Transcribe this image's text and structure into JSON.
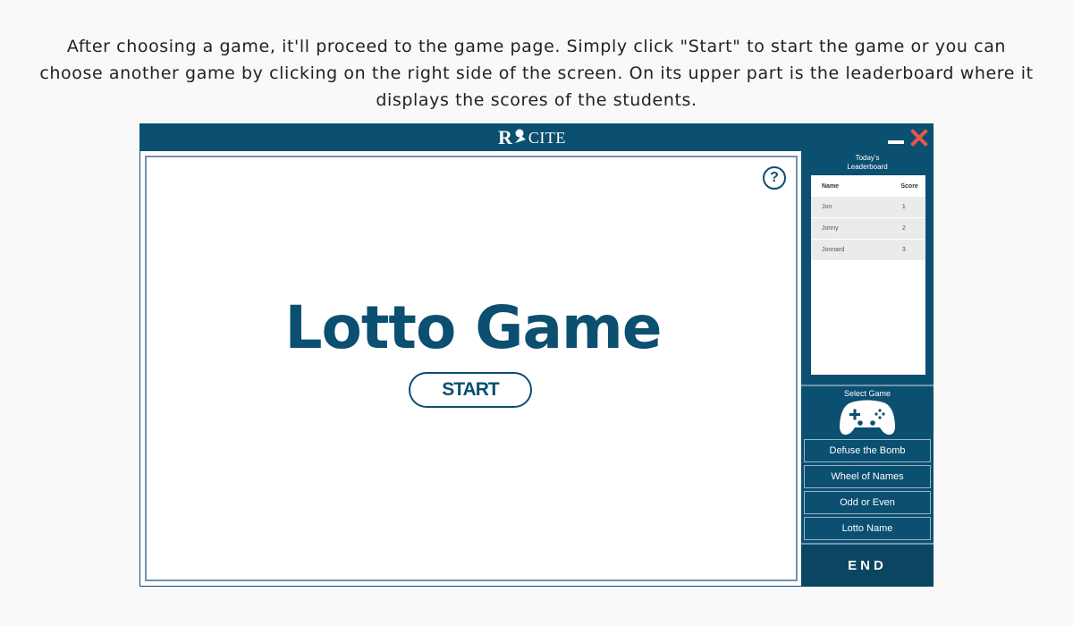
{
  "caption": "After choosing a game, it'll proceed to the game page. Simply click \"Start\" to start the game or you can choose another game by clicking on the right side of the screen. On its upper part is the leaderboard where it displays the scores of the students.",
  "app": {
    "logo_prefix": "R",
    "logo_suffix": "CITE"
  },
  "game": {
    "title": "Lotto Game",
    "start_label": "START",
    "help_label": "?"
  },
  "leaderboard": {
    "title_line1": "Today's",
    "title_line2": "Leaderboard",
    "col_name": "Name",
    "col_score": "Score",
    "rows": [
      {
        "name": "Jon",
        "score": "1"
      },
      {
        "name": "Jonny",
        "score": "2"
      },
      {
        "name": "Jonnard",
        "score": "3"
      }
    ]
  },
  "select_game": {
    "label": "Select Game",
    "items": [
      "Defuse the Bomb",
      "Wheel of Names",
      "Odd or Even",
      "Lotto Name"
    ]
  },
  "end_label": "END",
  "colors": {
    "primary": "#0b4f71",
    "close": "#e9574b",
    "row_bg": "#ebebeb"
  }
}
